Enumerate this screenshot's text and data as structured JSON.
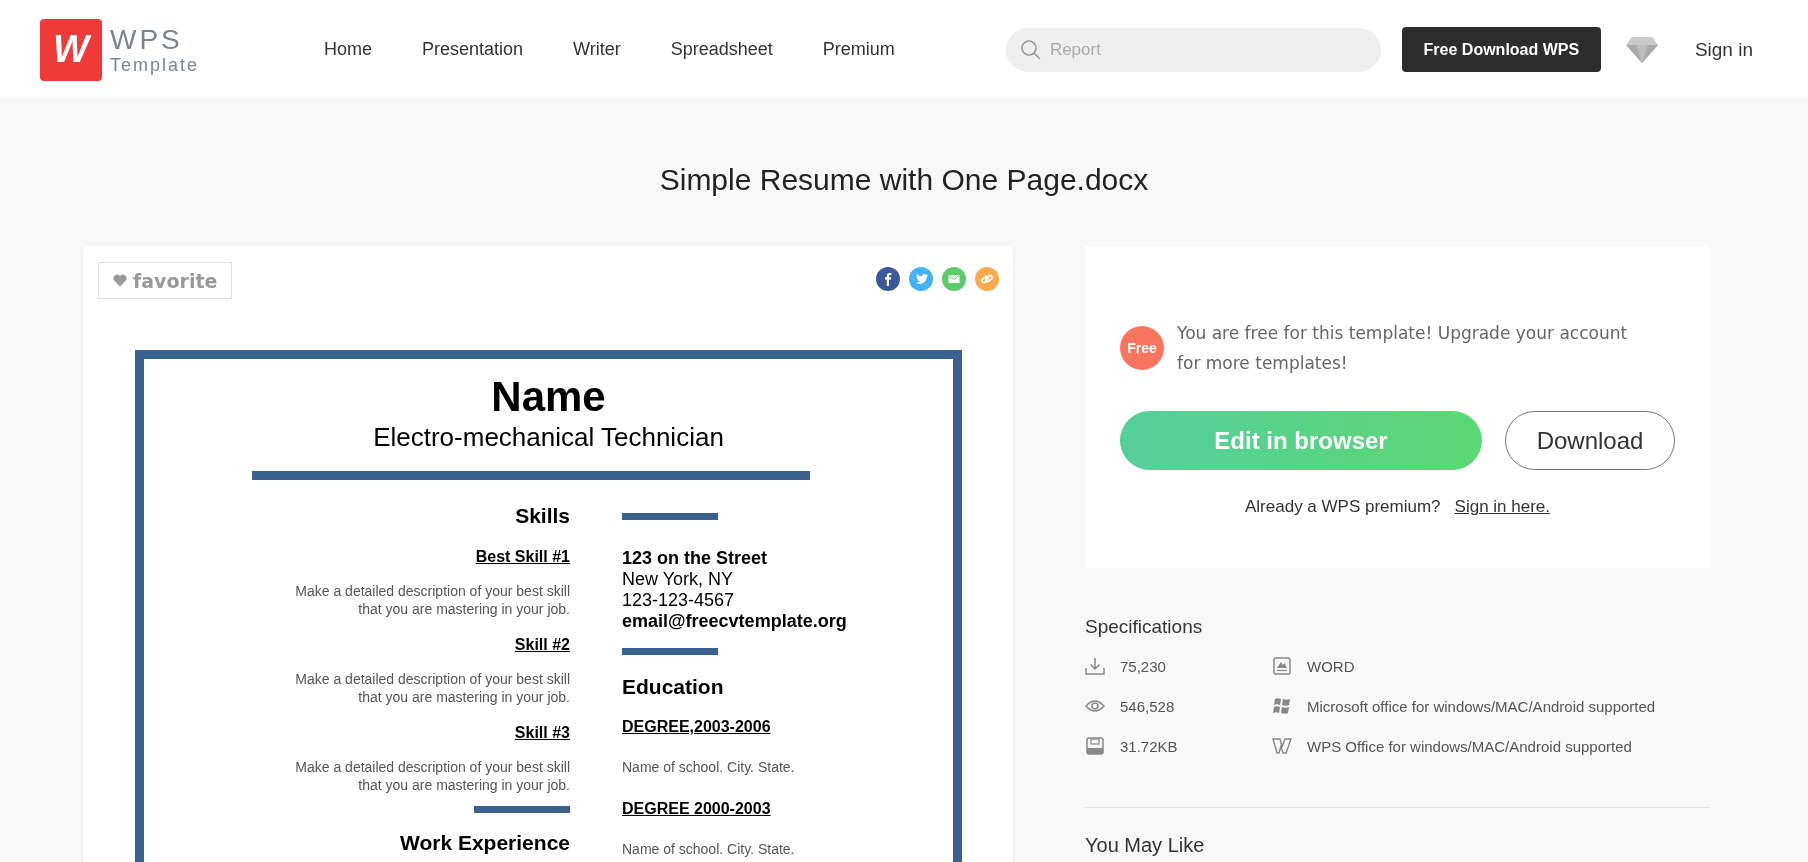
{
  "header": {
    "logo": {
      "mark": "W",
      "name": "WPS",
      "tagline": "Template"
    },
    "nav": [
      {
        "label": "Home"
      },
      {
        "label": "Presentation"
      },
      {
        "label": "Writer"
      },
      {
        "label": "Spreadsheet"
      },
      {
        "label": "Premium"
      }
    ],
    "search": {
      "placeholder": "Report"
    },
    "download_button": "Free Download WPS",
    "sign_in": "Sign in"
  },
  "title": "Simple Resume with One Page.docx",
  "preview": {
    "favorite": "favorite",
    "share": [
      {
        "kind": "facebook",
        "color": "#3b5998"
      },
      {
        "kind": "twitter",
        "color": "#43b1f2"
      },
      {
        "kind": "email",
        "color": "#5ecb6b"
      },
      {
        "kind": "link",
        "color": "#fca94b"
      }
    ],
    "resume": {
      "name": "Name",
      "role": "Electro-mechanical Technician",
      "skills_heading": "Skills",
      "skills": [
        {
          "title": "Best Skill #1",
          "description": "Make a detailed description of your best skill that you are mastering in your job."
        },
        {
          "title": "Skill #2",
          "description": "Make a detailed description of your best skill that you are mastering in your job."
        },
        {
          "title": "Skill #3",
          "description": "Make a detailed description of your best skill that you are mastering in your job."
        }
      ],
      "work_heading": "Work Experience",
      "contact": [
        {
          "text": "123 on the Street",
          "bold": true
        },
        {
          "text": "New York, NY",
          "bold": false
        },
        {
          "text": "123-123-4567",
          "bold": false
        },
        {
          "text": "email@freecvtemplate.org",
          "bold": true
        }
      ],
      "education_heading": "Education",
      "degrees": [
        {
          "title": "DEGREE,2003-2006",
          "school": "Name of school. City. State."
        },
        {
          "title": "DEGREE 2000-2003",
          "school": "Name of school. City. State."
        }
      ]
    }
  },
  "offer": {
    "badge": "Free",
    "message": "You are free for this template! Upgrade your account for more templates!",
    "edit_button": "Edit in browser",
    "download_button": "Download",
    "prompt": "Already a WPS premium?",
    "link": "Sign in here."
  },
  "specs": {
    "heading": "Specifications",
    "items": [
      {
        "kind": "downloads",
        "text": "75,230"
      },
      {
        "kind": "format",
        "text": "WORD"
      },
      {
        "kind": "views",
        "text": "546,528"
      },
      {
        "kind": "windows",
        "text": "Microsoft office for windows/MAC/Android supported"
      },
      {
        "kind": "size",
        "text": "31.72KB"
      },
      {
        "kind": "wps",
        "text": "WPS Office for windows/MAC/Android supported"
      }
    ]
  },
  "more_heading": "You May Like"
}
